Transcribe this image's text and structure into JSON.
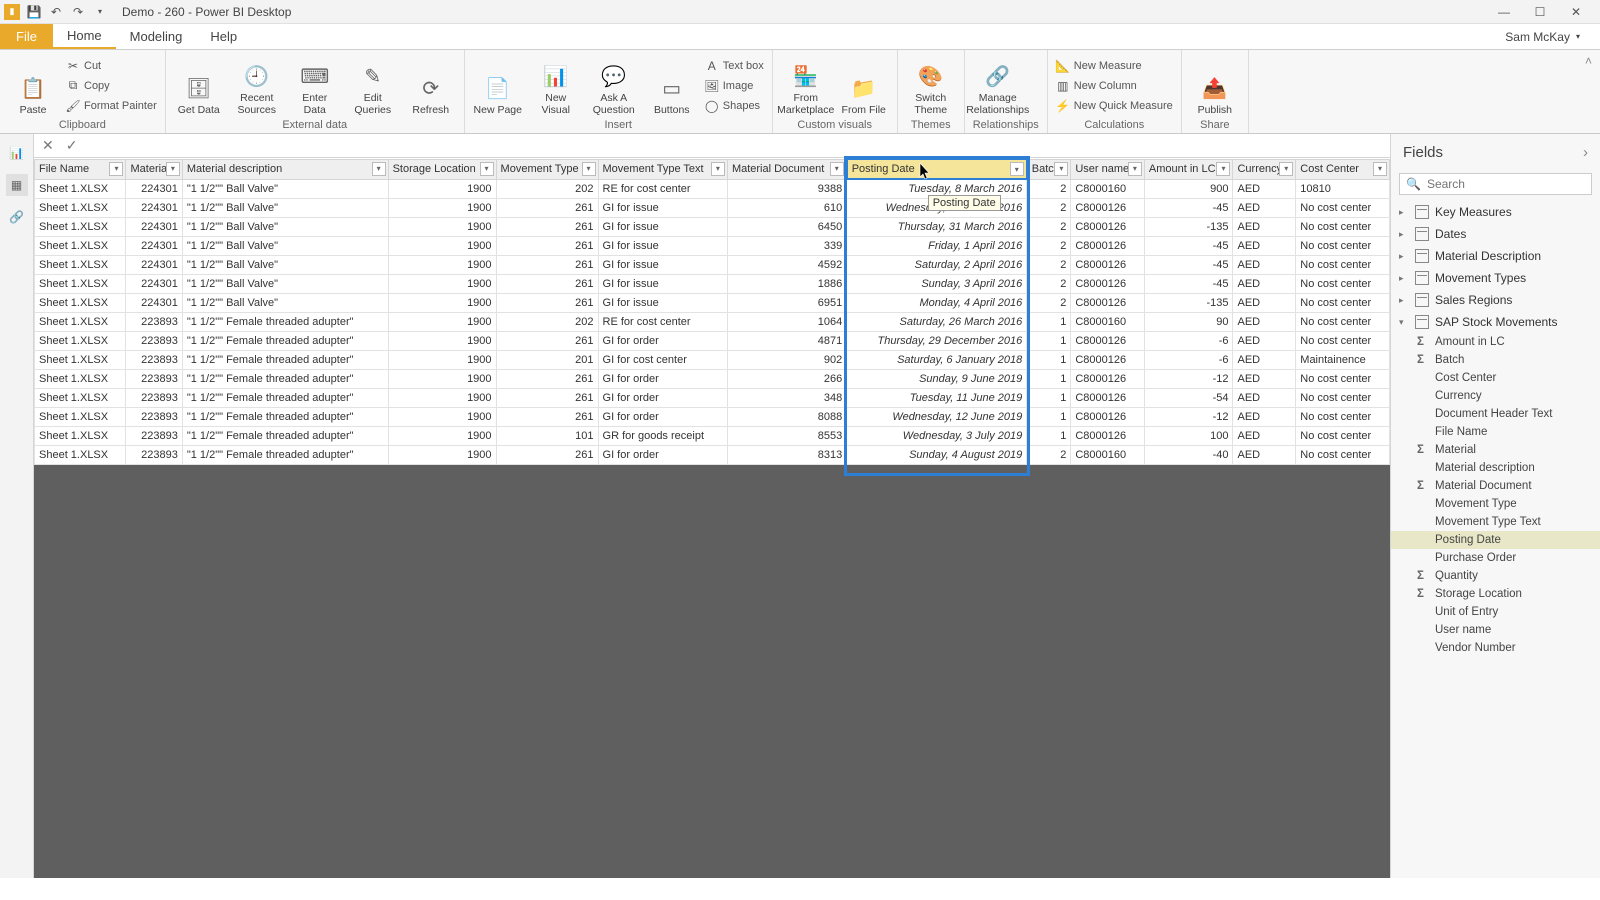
{
  "title": "Demo - 260 - Power BI Desktop",
  "user": "Sam McKay",
  "menu": {
    "file": "File",
    "home": "Home",
    "modeling": "Modeling",
    "help": "Help"
  },
  "ribbon": {
    "clipboard": {
      "label": "Clipboard",
      "paste": "Paste",
      "cut": "Cut",
      "copy": "Copy",
      "format": "Format Painter"
    },
    "external": {
      "label": "External data",
      "get": "Get Data",
      "recent": "Recent Sources",
      "enter": "Enter Data",
      "edit": "Edit Queries",
      "refresh": "Refresh"
    },
    "insert": {
      "label": "Insert",
      "page": "New Page",
      "visual": "New Visual",
      "ask": "Ask A Question",
      "buttons": "Buttons",
      "textbox": "Text box",
      "image": "Image",
      "shapes": "Shapes"
    },
    "custom": {
      "label": "Custom visuals",
      "market": "From Marketplace",
      "file": "From File"
    },
    "themes": {
      "label": "Themes",
      "switch": "Switch Theme"
    },
    "rel": {
      "label": "Relationships",
      "manage": "Manage Relationships"
    },
    "calc": {
      "label": "Calculations",
      "measure": "New Measure",
      "column": "New Column",
      "quick": "New Quick Measure"
    },
    "share": {
      "label": "Share",
      "publish": "Publish"
    }
  },
  "columns": [
    "File Name",
    "Material",
    "Material description",
    "Storage Location",
    "Movement Type",
    "Movement Type Text",
    "Material Document",
    "Posting Date",
    "Batch",
    "User name",
    "Amount in LC",
    "Currency",
    "Cost Center"
  ],
  "highlightedColumn": "Posting Date",
  "tooltip": "Posting Date",
  "rows": [
    {
      "file": "Sheet 1.XLSX",
      "mat": "224301",
      "desc": "\"1 1/2\"\" Ball Valve\"",
      "sloc": "1900",
      "mtype": "202",
      "mtext": "RE for cost center",
      "mdoc": "9388",
      "date": "Tuesday, 8 March 2016",
      "batch": "2",
      "user": "C8000160",
      "amt": "900",
      "cur": "AED",
      "cc": "10810"
    },
    {
      "file": "Sheet 1.XLSX",
      "mat": "224301",
      "desc": "\"1 1/2\"\" Ball Valve\"",
      "sloc": "1900",
      "mtype": "261",
      "mtext": "GI for issue",
      "mdoc": "610",
      "date": "Wednesday, 30 March 2016",
      "batch": "2",
      "user": "C8000126",
      "amt": "-45",
      "cur": "AED",
      "cc": "No cost center"
    },
    {
      "file": "Sheet 1.XLSX",
      "mat": "224301",
      "desc": "\"1 1/2\"\" Ball Valve\"",
      "sloc": "1900",
      "mtype": "261",
      "mtext": "GI for issue",
      "mdoc": "6450",
      "date": "Thursday, 31 March 2016",
      "batch": "2",
      "user": "C8000126",
      "amt": "-135",
      "cur": "AED",
      "cc": "No cost center"
    },
    {
      "file": "Sheet 1.XLSX",
      "mat": "224301",
      "desc": "\"1 1/2\"\" Ball Valve\"",
      "sloc": "1900",
      "mtype": "261",
      "mtext": "GI for issue",
      "mdoc": "339",
      "date": "Friday, 1 April 2016",
      "batch": "2",
      "user": "C8000126",
      "amt": "-45",
      "cur": "AED",
      "cc": "No cost center"
    },
    {
      "file": "Sheet 1.XLSX",
      "mat": "224301",
      "desc": "\"1 1/2\"\" Ball Valve\"",
      "sloc": "1900",
      "mtype": "261",
      "mtext": "GI for issue",
      "mdoc": "4592",
      "date": "Saturday, 2 April 2016",
      "batch": "2",
      "user": "C8000126",
      "amt": "-45",
      "cur": "AED",
      "cc": "No cost center"
    },
    {
      "file": "Sheet 1.XLSX",
      "mat": "224301",
      "desc": "\"1 1/2\"\" Ball Valve\"",
      "sloc": "1900",
      "mtype": "261",
      "mtext": "GI for issue",
      "mdoc": "1886",
      "date": "Sunday, 3 April 2016",
      "batch": "2",
      "user": "C8000126",
      "amt": "-45",
      "cur": "AED",
      "cc": "No cost center"
    },
    {
      "file": "Sheet 1.XLSX",
      "mat": "224301",
      "desc": "\"1 1/2\"\" Ball Valve\"",
      "sloc": "1900",
      "mtype": "261",
      "mtext": "GI for issue",
      "mdoc": "6951",
      "date": "Monday, 4 April 2016",
      "batch": "2",
      "user": "C8000126",
      "amt": "-135",
      "cur": "AED",
      "cc": "No cost center"
    },
    {
      "file": "Sheet 1.XLSX",
      "mat": "223893",
      "desc": "\"1 1/2\"\" Female threaded adupter\"",
      "sloc": "1900",
      "mtype": "202",
      "mtext": "RE for cost center",
      "mdoc": "1064",
      "date": "Saturday, 26 March 2016",
      "batch": "1",
      "user": "C8000160",
      "amt": "90",
      "cur": "AED",
      "cc": "No cost center"
    },
    {
      "file": "Sheet 1.XLSX",
      "mat": "223893",
      "desc": "\"1 1/2\"\" Female threaded adupter\"",
      "sloc": "1900",
      "mtype": "261",
      "mtext": "GI for order",
      "mdoc": "4871",
      "date": "Thursday, 29 December 2016",
      "batch": "1",
      "user": "C8000126",
      "amt": "-6",
      "cur": "AED",
      "cc": "No cost center"
    },
    {
      "file": "Sheet 1.XLSX",
      "mat": "223893",
      "desc": "\"1 1/2\"\" Female threaded adupter\"",
      "sloc": "1900",
      "mtype": "201",
      "mtext": "GI for cost center",
      "mdoc": "902",
      "date": "Saturday, 6 January 2018",
      "batch": "1",
      "user": "C8000126",
      "amt": "-6",
      "cur": "AED",
      "cc": "Maintainence"
    },
    {
      "file": "Sheet 1.XLSX",
      "mat": "223893",
      "desc": "\"1 1/2\"\" Female threaded adupter\"",
      "sloc": "1900",
      "mtype": "261",
      "mtext": "GI for order",
      "mdoc": "266",
      "date": "Sunday, 9 June 2019",
      "batch": "1",
      "user": "C8000126",
      "amt": "-12",
      "cur": "AED",
      "cc": "No cost center"
    },
    {
      "file": "Sheet 1.XLSX",
      "mat": "223893",
      "desc": "\"1 1/2\"\" Female threaded adupter\"",
      "sloc": "1900",
      "mtype": "261",
      "mtext": "GI for order",
      "mdoc": "348",
      "date": "Tuesday, 11 June 2019",
      "batch": "1",
      "user": "C8000126",
      "amt": "-54",
      "cur": "AED",
      "cc": "No cost center"
    },
    {
      "file": "Sheet 1.XLSX",
      "mat": "223893",
      "desc": "\"1 1/2\"\" Female threaded adupter\"",
      "sloc": "1900",
      "mtype": "261",
      "mtext": "GI for order",
      "mdoc": "8088",
      "date": "Wednesday, 12 June 2019",
      "batch": "1",
      "user": "C8000126",
      "amt": "-12",
      "cur": "AED",
      "cc": "No cost center"
    },
    {
      "file": "Sheet 1.XLSX",
      "mat": "223893",
      "desc": "\"1 1/2\"\" Female threaded adupter\"",
      "sloc": "1900",
      "mtype": "101",
      "mtext": "GR for goods receipt",
      "mdoc": "8553",
      "date": "Wednesday, 3 July 2019",
      "batch": "1",
      "user": "C8000126",
      "amt": "100",
      "cur": "AED",
      "cc": "No cost center"
    },
    {
      "file": "Sheet 1.XLSX",
      "mat": "223893",
      "desc": "\"1 1/2\"\" Female threaded adupter\"",
      "sloc": "1900",
      "mtype": "261",
      "mtext": "GI for order",
      "mdoc": "8313",
      "date": "Sunday, 4 August 2019",
      "batch": "2",
      "user": "C8000160",
      "amt": "-40",
      "cur": "AED",
      "cc": "No cost center"
    }
  ],
  "fields": {
    "title": "Fields",
    "searchPlaceholder": "Search",
    "tables": [
      {
        "name": "Key Measures",
        "expanded": false
      },
      {
        "name": "Dates",
        "expanded": false
      },
      {
        "name": "Material Description",
        "expanded": false
      },
      {
        "name": "Movement Types",
        "expanded": false
      },
      {
        "name": "Sales Regions",
        "expanded": false
      },
      {
        "name": "SAP Stock Movements",
        "expanded": true,
        "fields": [
          {
            "name": "Amount in LC",
            "sigma": true
          },
          {
            "name": "Batch",
            "sigma": true
          },
          {
            "name": "Cost Center",
            "sigma": false
          },
          {
            "name": "Currency",
            "sigma": false
          },
          {
            "name": "Document Header Text",
            "sigma": false
          },
          {
            "name": "File Name",
            "sigma": false
          },
          {
            "name": "Material",
            "sigma": true
          },
          {
            "name": "Material description",
            "sigma": false
          },
          {
            "name": "Material Document",
            "sigma": true
          },
          {
            "name": "Movement Type",
            "sigma": false
          },
          {
            "name": "Movement Type Text",
            "sigma": false
          },
          {
            "name": "Posting Date",
            "sigma": false,
            "selected": true
          },
          {
            "name": "Purchase Order",
            "sigma": false
          },
          {
            "name": "Quantity",
            "sigma": true
          },
          {
            "name": "Storage Location",
            "sigma": true
          },
          {
            "name": "Unit of Entry",
            "sigma": false
          },
          {
            "name": "User name",
            "sigma": false
          },
          {
            "name": "Vendor Number",
            "sigma": false
          }
        ]
      }
    ]
  }
}
